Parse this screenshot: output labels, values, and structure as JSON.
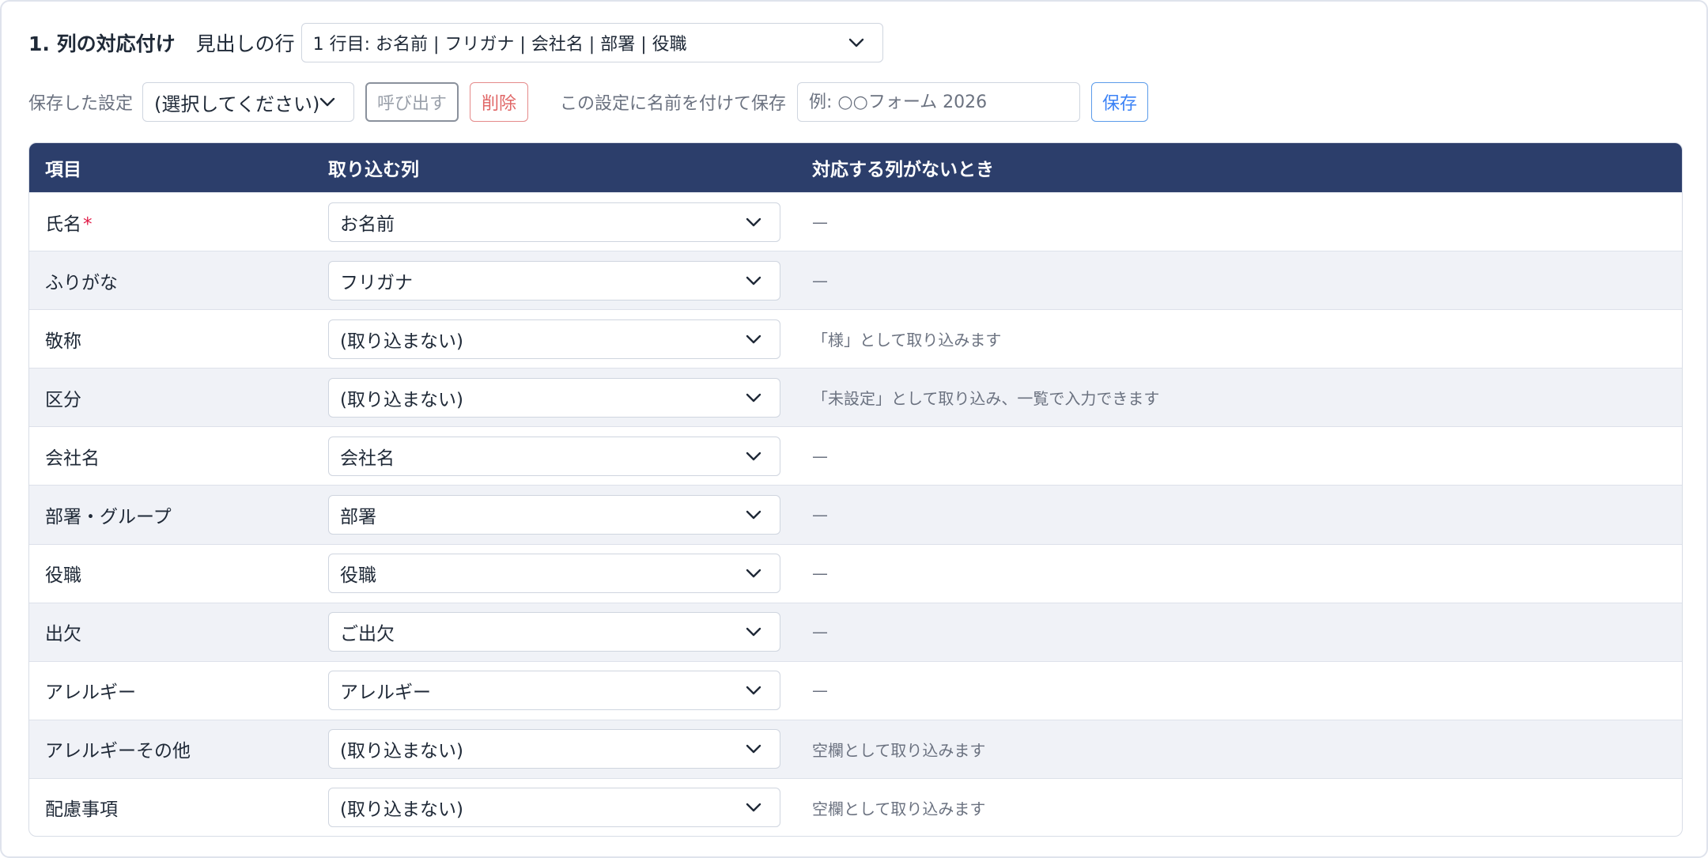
{
  "header": {
    "section_title": "1. 列の対応付け",
    "heading_row_label": "見出しの行",
    "heading_row_value": "1 行目: お名前 | フリガナ | 会社名 | 部署 | 役職"
  },
  "settings": {
    "saved_label": "保存した設定",
    "saved_select_value": "(選択してください)",
    "recall_button": "呼び出す",
    "delete_button": "削除",
    "save_name_label": "この設定に名前を付けて保存",
    "name_placeholder": "例: ○○フォーム 2026",
    "save_button": "保存"
  },
  "table": {
    "columns": [
      "項目",
      "取り込む列",
      "対応する列がないとき"
    ],
    "rows": [
      {
        "field": "氏名",
        "required_mark": "*",
        "column": "お名前",
        "fallback": "—"
      },
      {
        "field": "ふりがな",
        "column": "フリガナ",
        "fallback": "—"
      },
      {
        "field": "敬称",
        "column": "(取り込まない)",
        "fallback": "「様」として取り込みます"
      },
      {
        "field": "区分",
        "column": "(取り込まない)",
        "fallback": "「未設定」として取り込み、一覧で入力できます"
      },
      {
        "field": "会社名",
        "column": "会社名",
        "fallback": "—"
      },
      {
        "field": "部署・グループ",
        "column": "部署",
        "fallback": "—"
      },
      {
        "field": "役職",
        "column": "役職",
        "fallback": "—"
      },
      {
        "field": "出欠",
        "column": "ご出欠",
        "fallback": "—"
      },
      {
        "field": "アレルギー",
        "column": "アレルギー",
        "fallback": "—"
      },
      {
        "field": "アレルギーその他",
        "column": "(取り込まない)",
        "fallback": "空欄として取り込みます"
      },
      {
        "field": "配慮事項",
        "column": "(取り込まない)",
        "fallback": "空欄として取り込みます"
      }
    ]
  },
  "colors": {
    "table_header_bg": "#2c3e6b",
    "alt_row_bg": "#f0f2f7",
    "delete_red": "#e06666",
    "save_blue": "#3b82f6",
    "required_red": "#e11d48"
  },
  "icons": {
    "dropdown": "chevron-down-icon"
  }
}
